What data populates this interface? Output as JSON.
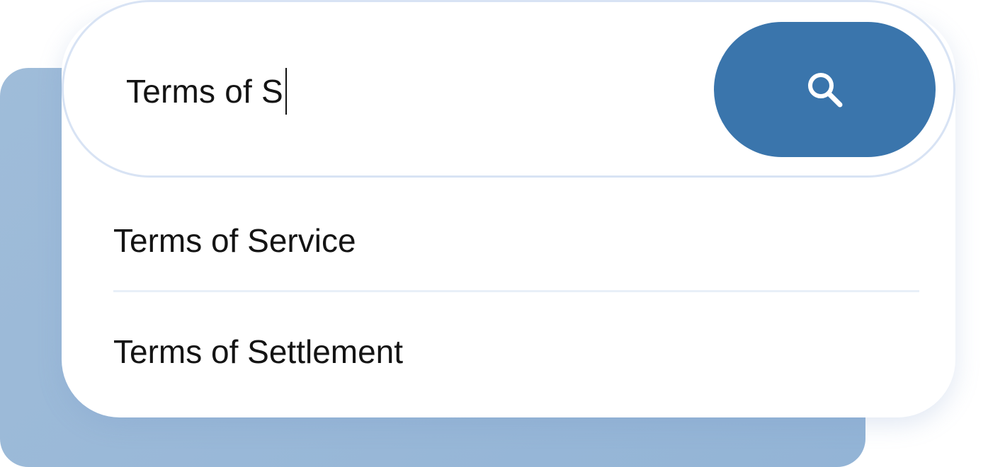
{
  "search": {
    "query": "Terms of S",
    "button_icon": "search-icon"
  },
  "suggestions": [
    {
      "label": "Terms of Service"
    },
    {
      "label": "Terms of Settlement"
    }
  ],
  "colors": {
    "accent": "#3a75ac",
    "backdrop": "#9ab8d8",
    "border": "#d8e3f4",
    "divider": "#e8eff8",
    "text": "#141414"
  }
}
